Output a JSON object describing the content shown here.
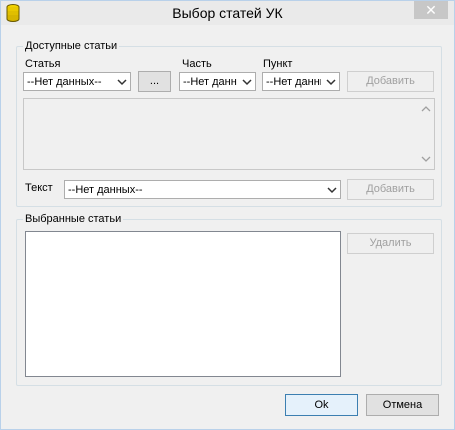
{
  "window": {
    "title": "Выбор статей УК",
    "close_glyph": "✕"
  },
  "available": {
    "legend": "Доступные статьи",
    "article_label": "Статья",
    "part_label": "Часть",
    "item_label": "Пункт",
    "article_value": "--Нет данных--",
    "browse_label": "...",
    "part_value": "--Нет данных--",
    "item_value": "--Нет данных--",
    "add_label": "Добавить",
    "text_label": "Текст",
    "text_value": "--Нет данных--",
    "add_text_label": "Добавить"
  },
  "selected": {
    "legend": "Выбранные статьи",
    "remove_label": "Удалить"
  },
  "footer": {
    "ok_label": "Ok",
    "cancel_label": "Отмена"
  },
  "colors": {
    "accent": "#3c7fb1",
    "disabled_text": "#a0a0a0",
    "group_border": "#d5dfe5"
  }
}
